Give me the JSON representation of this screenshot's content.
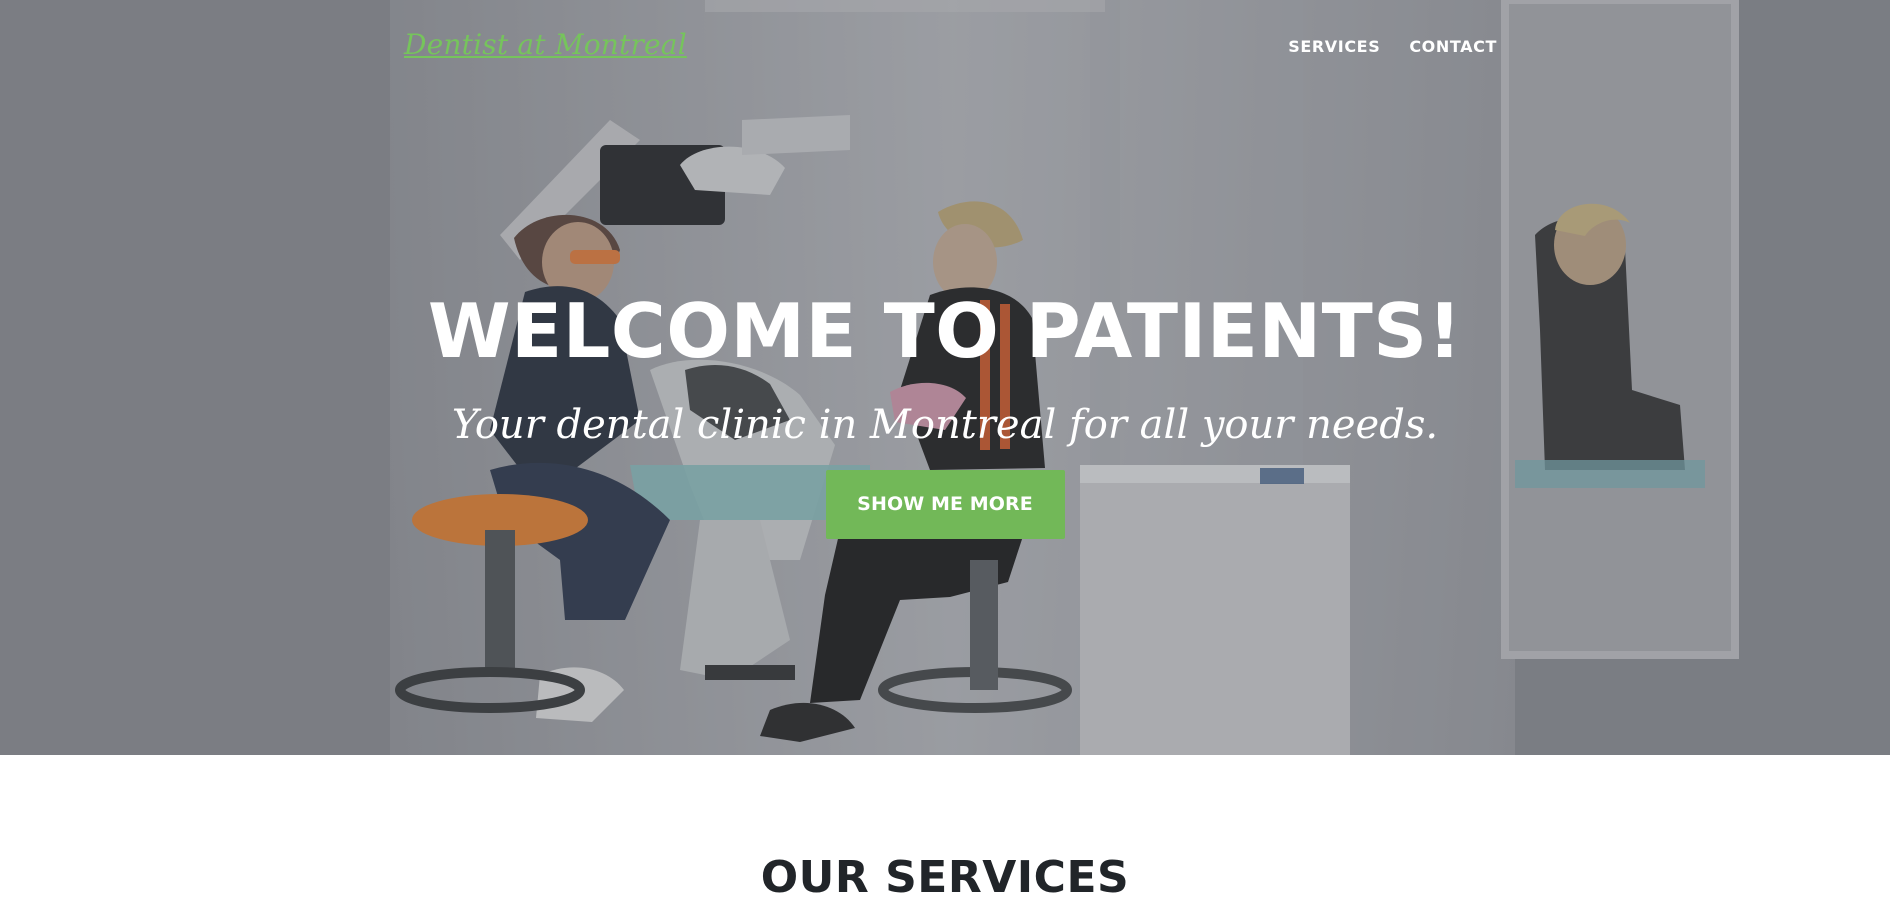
{
  "header": {
    "brand": "Dentist at Montreal",
    "nav": [
      {
        "label": "SERVICES"
      },
      {
        "label": "CONTACT"
      }
    ]
  },
  "hero": {
    "title": "WELCOME TO PATIENTS!",
    "subtitle": "Your dental clinic in Montreal for all your needs.",
    "button_label": "SHOW ME MORE"
  },
  "services": {
    "heading": "OUR SERVICES"
  },
  "colors": {
    "accent": "#72b858",
    "brand_text": "#76c45c",
    "dark_text": "#212529",
    "overlay": "#56585e"
  }
}
